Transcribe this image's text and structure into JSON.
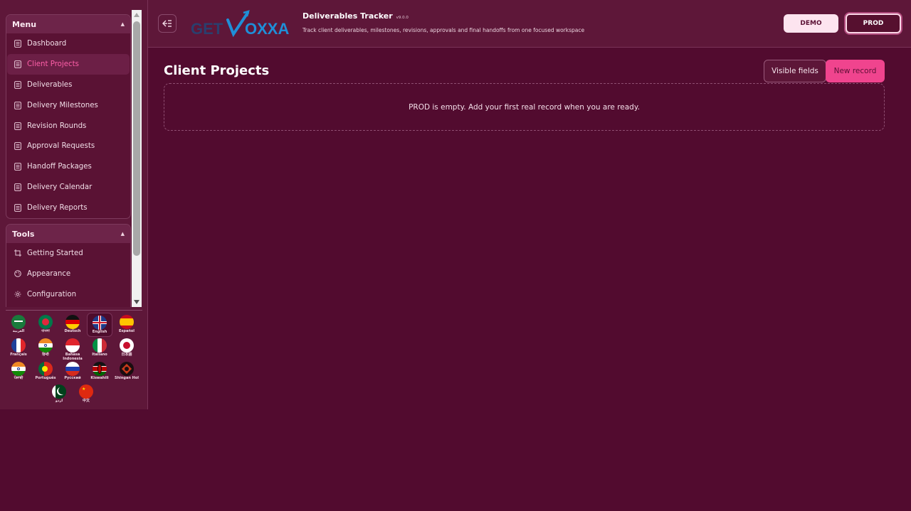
{
  "colors": {
    "background": "#520b2f",
    "sidebar": "#5e1739",
    "accent": "#f0448e",
    "active_text": "#ff5fa9"
  },
  "header": {
    "logo_text_left": "GET",
    "logo_text_right": "OXXA",
    "title": "Deliverables Tracker",
    "version": "v9.0.0",
    "subtitle": "Track client deliverables, milestones, revisions, approvals and final handoffs from one focused workspace",
    "demo_label": "DEMO",
    "prod_label": "PROD",
    "collapse_icon": "collapse-sidebar-icon"
  },
  "sidebar": {
    "menu": {
      "title": "Menu",
      "items": [
        {
          "label": "Dashboard",
          "icon": "list-icon",
          "active": false
        },
        {
          "label": "Client Projects",
          "icon": "list-icon",
          "active": true
        },
        {
          "label": "Deliverables",
          "icon": "list-icon",
          "active": false
        },
        {
          "label": "Delivery Milestones",
          "icon": "list-icon",
          "active": false
        },
        {
          "label": "Revision Rounds",
          "icon": "list-icon",
          "active": false
        },
        {
          "label": "Approval Requests",
          "icon": "list-icon",
          "active": false
        },
        {
          "label": "Handoff Packages",
          "icon": "list-icon",
          "active": false
        },
        {
          "label": "Delivery Calendar",
          "icon": "list-icon",
          "active": false
        },
        {
          "label": "Delivery Reports",
          "icon": "list-icon",
          "active": false
        }
      ]
    },
    "tools": {
      "title": "Tools",
      "items": [
        {
          "label": "Getting Started",
          "icon": "crop-icon"
        },
        {
          "label": "Appearance",
          "icon": "palette-icon"
        },
        {
          "label": "Configuration",
          "icon": "gear-icon"
        }
      ]
    },
    "languages": [
      {
        "label": "العربية",
        "flag": "saudi-flag-icon",
        "selected": false
      },
      {
        "label": "বাংলা",
        "flag": "bangladesh-flag-icon",
        "selected": false
      },
      {
        "label": "Deutsch",
        "flag": "germany-flag-icon",
        "selected": false
      },
      {
        "label": "English",
        "flag": "uk-flag-icon",
        "selected": true
      },
      {
        "label": "Español",
        "flag": "spain-flag-icon",
        "selected": false
      },
      {
        "label": "Français",
        "flag": "france-flag-icon",
        "selected": false
      },
      {
        "label": "हिन्दी",
        "flag": "india-flag-icon",
        "selected": false
      },
      {
        "label": "Bahasa Indonesia",
        "flag": "indonesia-flag-icon",
        "selected": false
      },
      {
        "label": "Italiano",
        "flag": "italy-flag-icon",
        "selected": false
      },
      {
        "label": "日本語",
        "flag": "japan-flag-icon",
        "selected": false
      },
      {
        "label": "ਪੰਜਾਬੀ",
        "flag": "india-flag-icon",
        "selected": false
      },
      {
        "label": "Português",
        "flag": "portugal-flag-icon",
        "selected": false
      },
      {
        "label": "Русский",
        "flag": "russia-flag-icon",
        "selected": false
      },
      {
        "label": "Kiswahili",
        "flag": "kenya-flag-icon",
        "selected": false
      },
      {
        "label": "Shingan Hol",
        "flag": "shingan-flag-icon",
        "selected": false
      },
      {
        "label": "اردو",
        "flag": "pakistan-flag-icon",
        "selected": false
      },
      {
        "label": "中文",
        "flag": "china-flag-icon",
        "selected": false
      }
    ]
  },
  "main": {
    "page_title": "Client Projects",
    "visible_fields_label": "Visible fields",
    "new_record_label": "New record",
    "empty_message": "PROD is empty. Add your first real record when you are ready."
  }
}
